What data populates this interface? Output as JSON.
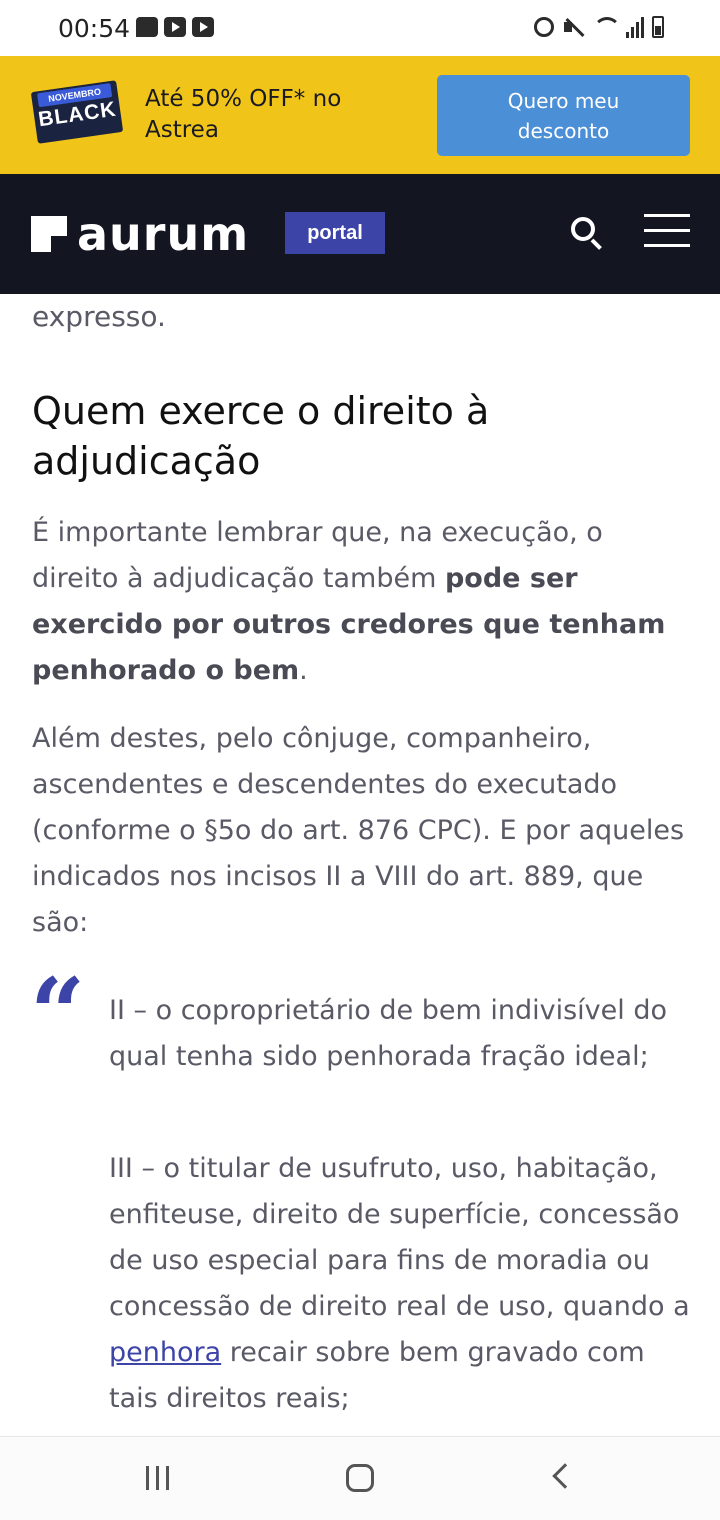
{
  "status_bar": {
    "time": "00:54",
    "notification_icons": [
      "message-icon",
      "youtube-icon",
      "youtube-icon"
    ],
    "right_icons": [
      "alarm-icon",
      "mute-icon",
      "wifi-icon",
      "signal-icon",
      "battery-icon"
    ]
  },
  "promo": {
    "badge_top": "NOVEMBRO",
    "badge_main": "BLACK",
    "text": "Até 50% OFF* no Astrea",
    "button_label": "Quero meu desconto",
    "background_color": "#f1c419",
    "button_color": "#4b8fd6"
  },
  "header": {
    "logo_text": "aurum",
    "tag": "portal",
    "background_color": "#131521",
    "tag_color": "#3d44a8"
  },
  "article": {
    "fragment": "expresso.",
    "heading": "Quem exerce o direito à adjudicação",
    "para1": {
      "before": "É importante lembrar que, na execução, o direito à adjudicação também ",
      "bold": "pode ser exercido por outros credores que tenham penhorado o bem",
      "after": "."
    },
    "para2": "Além destes, pelo cônjuge, companheiro, ascendentes e descendentes do executado (conforme o §5o do art. 876 CPC). E por aqueles indicados nos incisos II a VIII do art. 889, que são:",
    "quote_mark": "“",
    "quote1": "II – o coproprietário de bem indivisível do qual tenha sido penhorada fração ideal;",
    "quote2": {
      "before": "III – o titular de usufruto, uso, habitação, enfiteuse, direito de superfície, concessão de uso especial para fins de moradia ou concessão de direito real de uso, quando a ",
      "link": "penhora",
      "after": " recair sobre bem gravado com tais direitos reais;"
    }
  },
  "navbar": {
    "icons": [
      "recent-apps-icon",
      "home-icon",
      "back-icon"
    ]
  }
}
